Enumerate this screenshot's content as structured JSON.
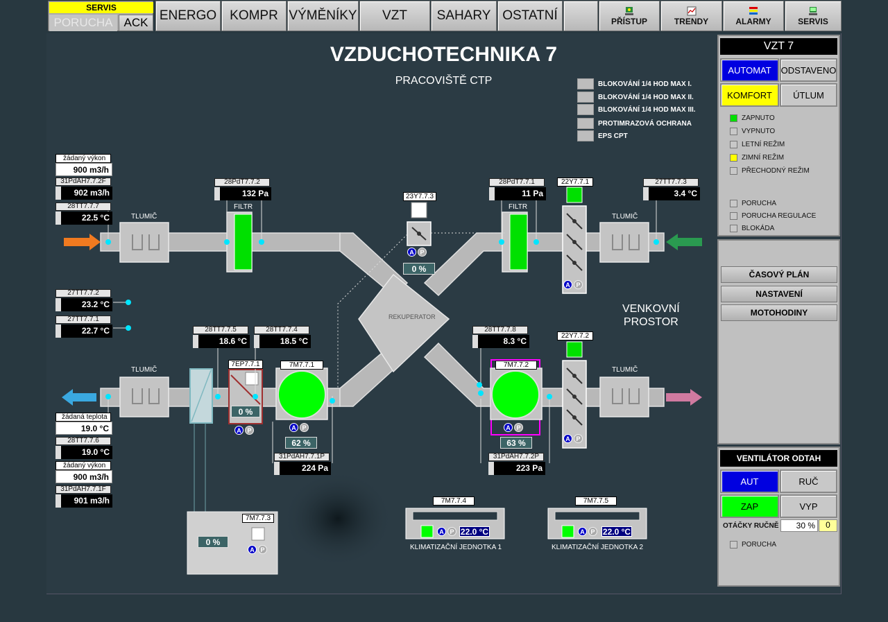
{
  "header": {
    "servis": "SERVIS",
    "porucha": "PORUCHA",
    "ack": "ACK",
    "nav": [
      "ENERGO",
      "KOMPR",
      "VÝMĚNÍKY",
      "VZT",
      "SAHARY",
      "OSTATNÍ"
    ],
    "icon_buttons": [
      {
        "label": "PŘÍSTUP",
        "icon": "access-icon"
      },
      {
        "label": "TRENDY",
        "icon": "trend-icon"
      },
      {
        "label": "ALARMY",
        "icon": "alarm-icon"
      },
      {
        "label": "SERVIS",
        "icon": "service-icon"
      }
    ]
  },
  "main": {
    "title": "VZDUCHOTECHNIKA 7",
    "subtitle": "PRACOVIŠTĚ CTP",
    "outside": [
      "VENKOVNÍ",
      "PROSTOR"
    ],
    "legend": [
      "BLOKOVÁNÍ 1/4 HOD MAX I.",
      "BLOKOVÁNÍ 1/4 HOD MAX II.",
      "BLOKOVÁNÍ 1/4 HOD MAX III.",
      "PROTIMRAZOVÁ OCHRANA",
      "EPS CPT"
    ],
    "left_top": {
      "zad_vykon_label": "žádaný výkon",
      "zad_vykon": "900 m3/h",
      "tag1": "31PdAH7.7.2F",
      "val1": "902 m3/h",
      "tag2": "28TT7.7.7",
      "val2": "22.5 °C"
    },
    "left_mid": {
      "tag1": "27TT7.7.2",
      "val1": "23.2 °C",
      "tag2": "27TT7.7.1",
      "val2": "22.7 °C"
    },
    "left_bottom": {
      "zad_teplota_label": "žádaná teplota",
      "zad_teplota": "19.0 °C",
      "tag1": "28TT7.7.6",
      "val1": "19.0 °C",
      "zad_vykon_label": "žádaný výkon",
      "zad_vykon": "900 m3/h",
      "tag2": "31PdAH7.7.1F",
      "val2": "901 m3/h"
    },
    "tlumic": "TLUMIČ",
    "filtr": "FILTR",
    "rekuperator": "REKUPERATOR",
    "top": {
      "filter_left_tag": "28PdT7.7.2",
      "filter_left_val": "132 Pa",
      "bypass_tag": "23Y7.7.3",
      "bypass_pct": "0 %",
      "filter_right_tag": "28PdT7.7.1",
      "filter_right_val": "11 Pa",
      "damper_tag": "22Y7.7.1",
      "outside_temp_tag": "27TT7.7.3",
      "outside_temp": "3.4 °C"
    },
    "bottom": {
      "t5_tag": "28TT7.7.5",
      "t5": "18.6 °C",
      "t4_tag": "28TT7.7.4",
      "t4": "18.5 °C",
      "heater_tag": "7EP7.7.1",
      "heater_pct": "0 %",
      "fan1_tag": "7M7.7.1",
      "fan1_pct": "62 %",
      "fan1_p_tag": "31PdAH7.7.1P",
      "fan1_p": "224 Pa",
      "t8_tag": "28TT7.7.8",
      "t8": "8.3 °C",
      "fan2_tag": "7M7.7.2",
      "fan2_pct": "63 %",
      "fan2_p_tag": "31PdAH7.7.2P",
      "fan2_p": "223 Pa",
      "damper2_tag": "22Y7.7.2",
      "pump_tag": "7M7.7.3",
      "pump_pct": "0 %",
      "ac1_tag": "7M7.7.4",
      "ac1_temp": "22.0 °C",
      "ac1_label": "KLIMATIZAČNÍ JEDNOTKA 1",
      "ac2_tag": "7M7.7.5",
      "ac2_temp": "22.0 °C",
      "ac2_label": "KLIMATIZAČNÍ JEDNOTKA 2"
    },
    "ap": {
      "a": "A",
      "p": "P"
    }
  },
  "panel": {
    "title": "VZT 7",
    "automat": "AUTOMAT",
    "odstaveno": "ODSTAVENO",
    "komfort": "KOMFORT",
    "utlum": "ÚTLUM",
    "status": [
      "ZAPNUTO",
      "VYPNUTO",
      "LETNÍ REŽIM",
      "ZIMNÍ REŽIM",
      "PŘECHODNÝ REŽIM"
    ],
    "faults": [
      "PORUCHA",
      "PORUCHA REGULACE",
      "BLOKÁDA"
    ],
    "menu": [
      "ČASOVÝ PLÁN",
      "NASTAVENÍ",
      "MOTOHODINY"
    ],
    "fan_title": "VENTILÁTOR ODTAH",
    "aut": "AUT",
    "ruc": "RUČ",
    "zap": "ZAP",
    "vyp": "VYP",
    "otacky_label": "OTÁČKY RUČNĚ",
    "otacky": "30 %",
    "otacky_set": "0",
    "fan_porucha": "PORUCHA"
  },
  "colors": {
    "green": "#00ff00",
    "blue": "#0000e0",
    "yellow": "#ffff00",
    "duct": "#b4b4b4",
    "bg": "#2b3b44",
    "magenta": "#ff00ff"
  }
}
